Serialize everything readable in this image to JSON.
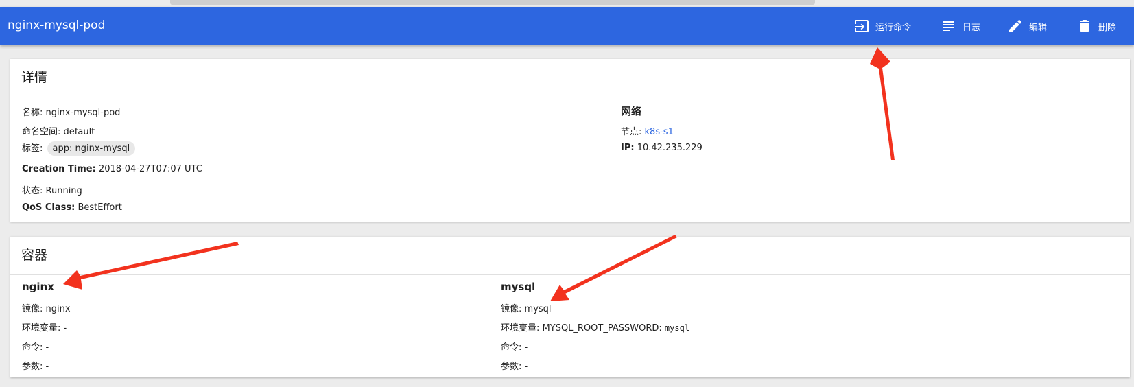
{
  "toolbar": {
    "title": "nginx-mysql-pod",
    "actions": [
      {
        "label": "运行命令",
        "icon": "exec-icon"
      },
      {
        "label": "日志",
        "icon": "logs-icon"
      },
      {
        "label": "编辑",
        "icon": "pencil-icon"
      },
      {
        "label": "删除",
        "icon": "trash-icon"
      }
    ]
  },
  "details": {
    "title": "详情",
    "name_label": "名称:",
    "name_value": "nginx-mysql-pod",
    "namespace_label": "命名空间:",
    "namespace_value": "default",
    "labels_label": "标签:",
    "label_chip": "app: nginx-mysql",
    "creation_label": "Creation Time:",
    "creation_value": "2018-04-27T07:07 UTC",
    "status_label": "状态:",
    "status_value": "Running",
    "qos_label": "QoS Class:",
    "qos_value": "BestEffort",
    "network_title": "网络",
    "node_label": "节点:",
    "node_value": "k8s-s1",
    "ip_label": "IP:",
    "ip_value": "10.42.235.229"
  },
  "containers": {
    "title": "容器",
    "items": [
      {
        "name": "nginx",
        "image_label": "镜像:",
        "image_value": "nginx",
        "env_label": "环境变量:",
        "env_value": "-",
        "env_secret": "",
        "cmd_label": "命令:",
        "cmd_value": "-",
        "args_label": "参数:",
        "args_value": "-"
      },
      {
        "name": "mysql",
        "image_label": "镜像:",
        "image_value": "mysql",
        "env_label": "环境变量:",
        "env_value": "MYSQL_ROOT_PASSWORD:",
        "env_secret": "mysql",
        "cmd_label": "命令:",
        "cmd_value": "-",
        "args_label": "参数:",
        "args_value": "-"
      }
    ]
  },
  "colors": {
    "toolbar": "#2d66e0",
    "link": "#2d66e0",
    "annotation_arrow": "#f2321e"
  }
}
